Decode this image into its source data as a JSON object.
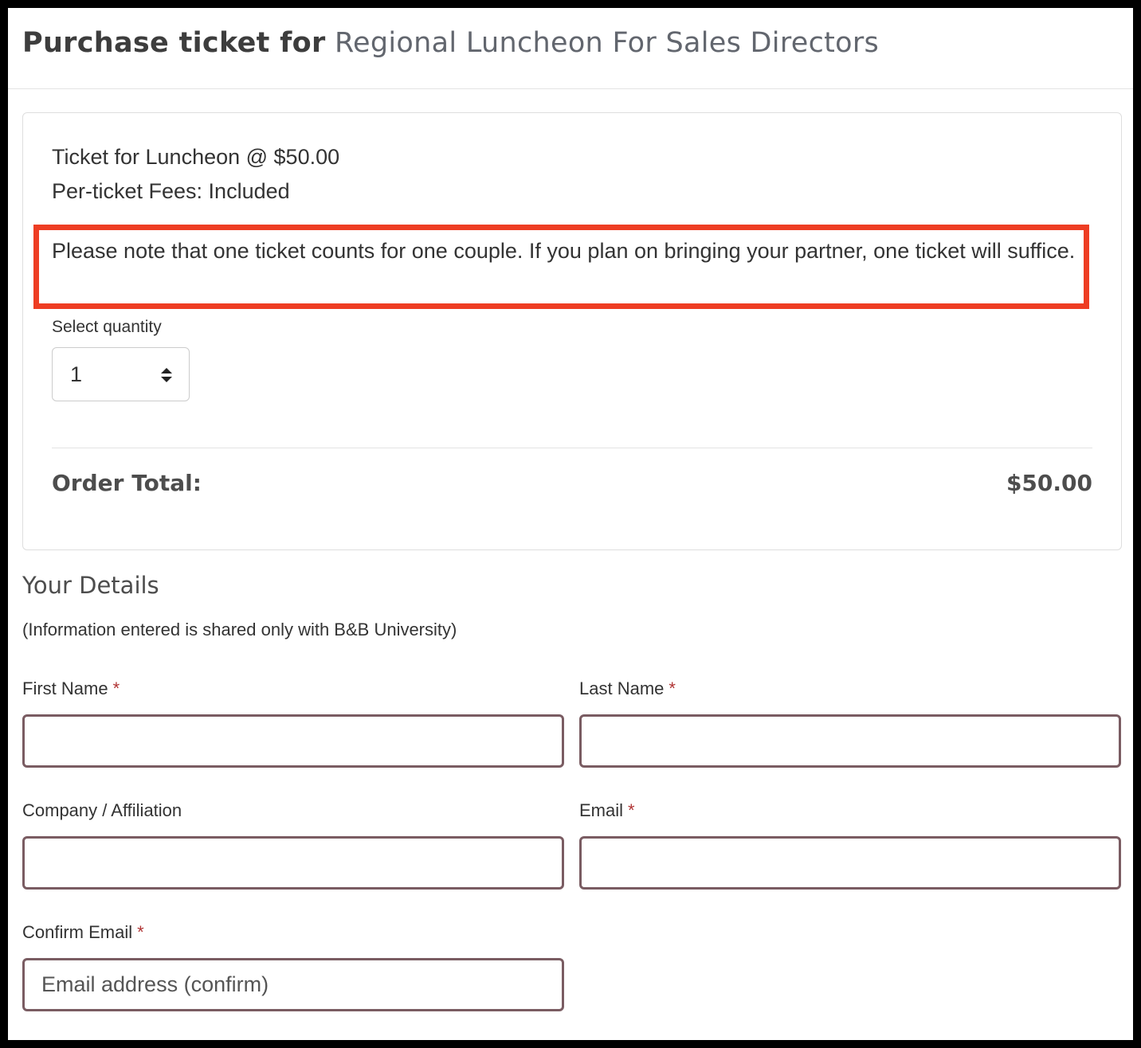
{
  "header": {
    "title_prefix": "Purchase ticket for",
    "event_name": "Regional Luncheon For Sales Directors"
  },
  "ticket": {
    "line": "Ticket for Luncheon @ $50.00",
    "fees": "Per-ticket Fees: Included",
    "note": "Please note that one ticket counts for one couple. If you plan on bringing your partner, one ticket will suffice.",
    "quantity_label": "Select quantity",
    "quantity_value": "1"
  },
  "order": {
    "total_label": "Order Total:",
    "total_value": "$50.00"
  },
  "details": {
    "title": "Your Details",
    "note": "(Information entered is shared only with B&B University)",
    "required_marker": "*",
    "fields": {
      "first_name": {
        "label": "First Name",
        "placeholder": ""
      },
      "last_name": {
        "label": "Last Name",
        "placeholder": ""
      },
      "company": {
        "label": "Company / Affiliation",
        "placeholder": ""
      },
      "email": {
        "label": "Email",
        "placeholder": ""
      },
      "confirm_email": {
        "label": "Confirm Email",
        "placeholder": "Email address (confirm)"
      }
    }
  },
  "colors": {
    "highlight_border": "#ee3d23",
    "input_border": "#7a5c62",
    "required": "#b03434"
  },
  "icons": {
    "quantity_stepper": "up-down-arrows-icon"
  }
}
